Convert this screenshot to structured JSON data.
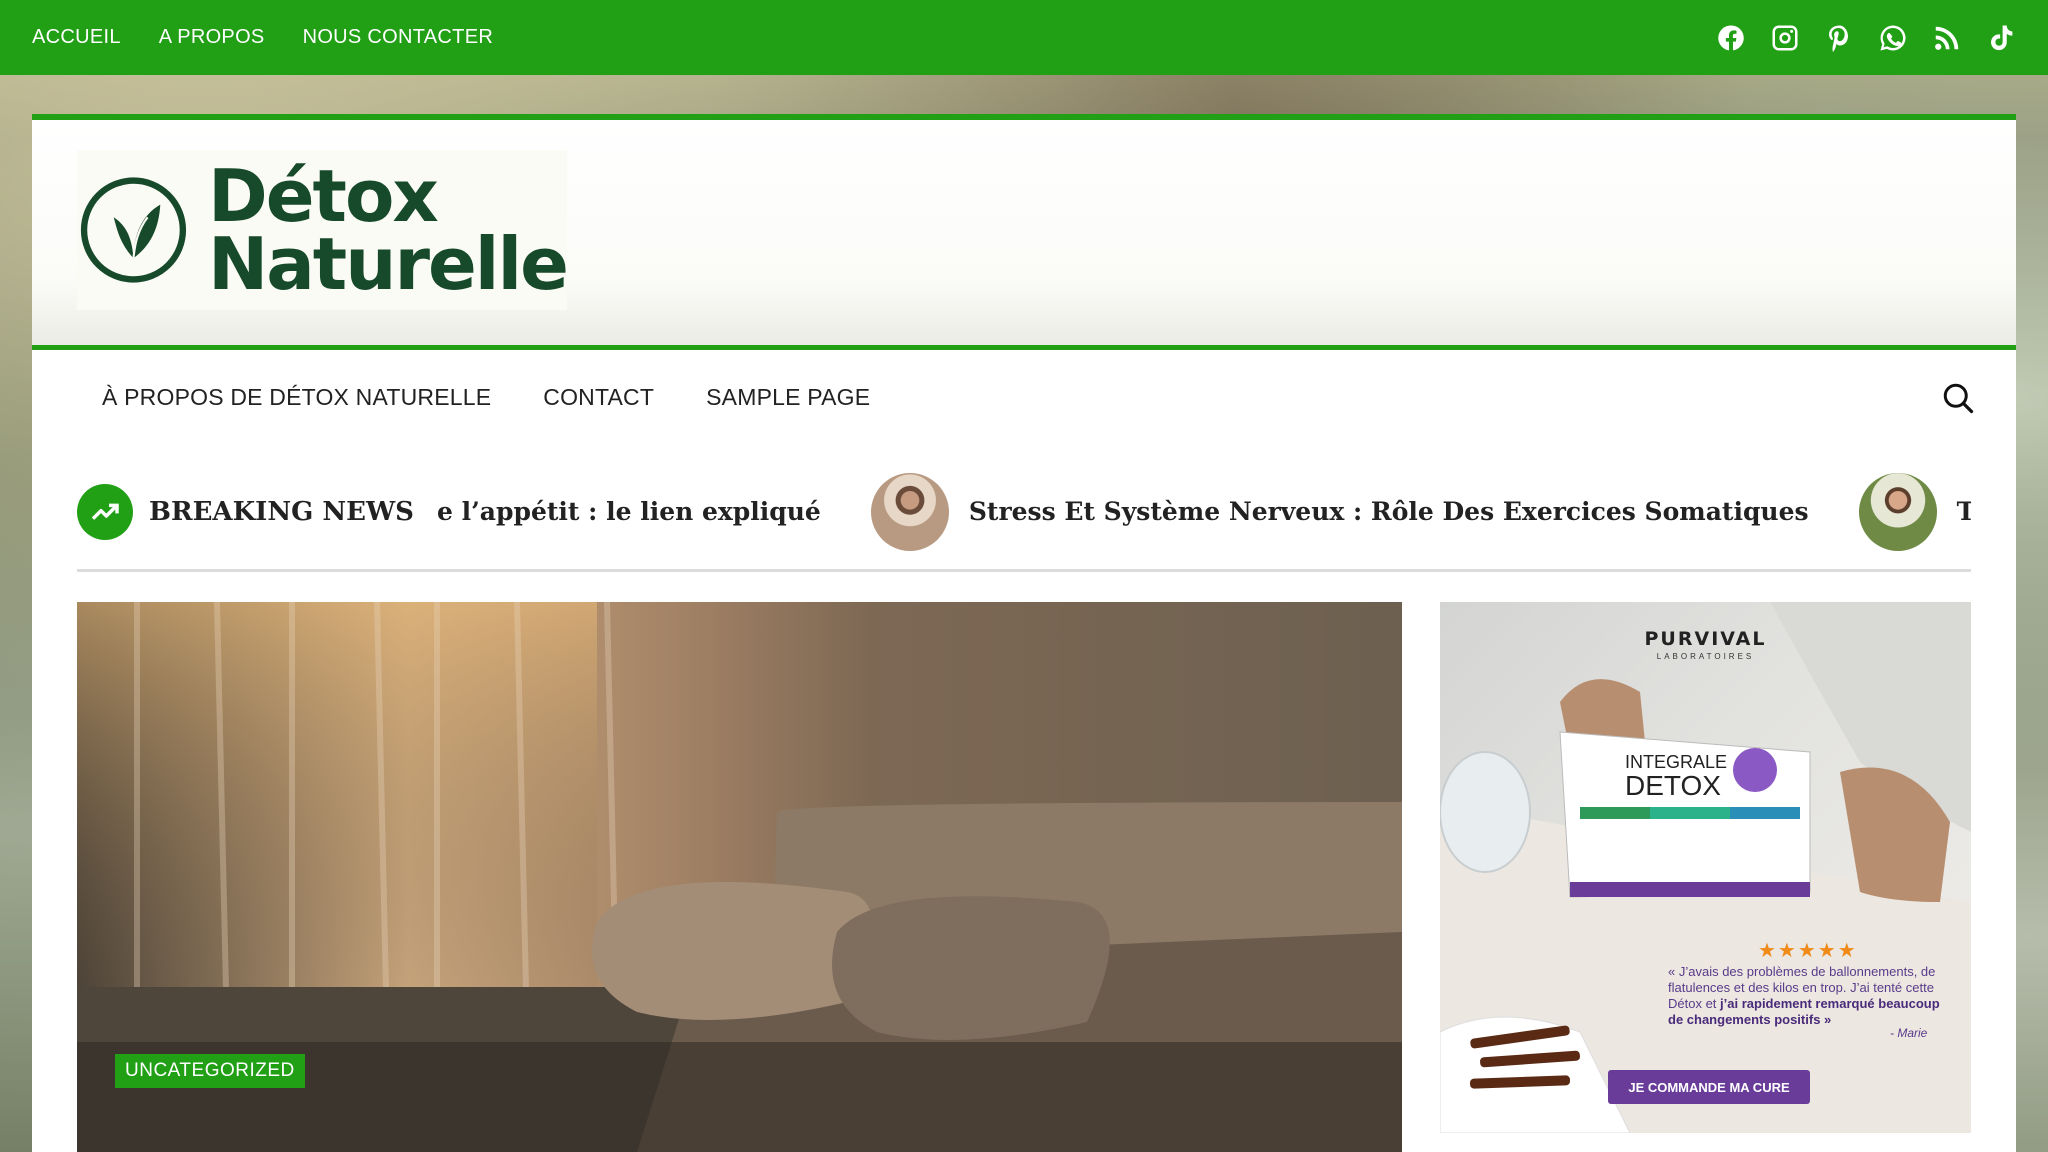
{
  "topbar": {
    "nav": [
      "ACCUEIL",
      "A PROPOS",
      "NOUS CONTACTER"
    ],
    "social_icons": [
      "facebook-icon",
      "instagram-icon",
      "pinterest-icon",
      "whatsapp-icon",
      "rss-icon",
      "tiktok-icon"
    ],
    "bg_color": "#21a016"
  },
  "logo": {
    "line1": "Détox",
    "line2": "Naturelle",
    "color": "#174a2a"
  },
  "mainnav": {
    "items": [
      "À PROPOS DE DÉTOX NATURELLE",
      "CONTACT",
      "SAMPLE PAGE"
    ]
  },
  "ticker": {
    "label": "BREAKING NEWS",
    "items": [
      "e l’appétit : le lien expliqué",
      "Stress Et Système Nerveux : Rôle Des Exercices Somatiques",
      "Techniques de"
    ]
  },
  "hero": {
    "category": "UNCATEGORIZED"
  },
  "ad": {
    "brand": "PURVIVAL",
    "brand_sub": "LABORATOIRES",
    "box_title1": "INTEGRALE",
    "box_title2": "DETOX",
    "stars": "★★★★★",
    "quote_start": "« J’avais des problèmes de ballonnements, de flatulences et des kilos en trop. J’ai tenté cette Détox et ",
    "quote_bold": "j’ai rapidement remarqué beaucoup de changements positifs",
    "quote_end": " »",
    "author": "- Marie",
    "cta": "JE COMMANDE MA CURE"
  }
}
